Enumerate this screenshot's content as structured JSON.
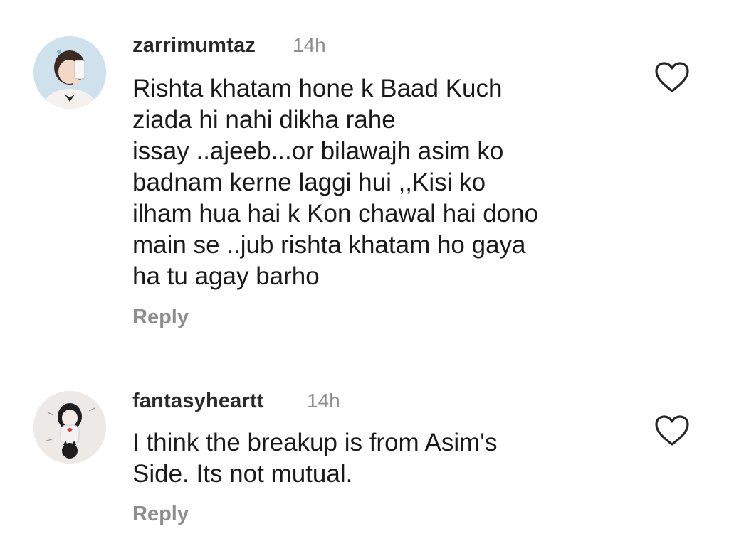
{
  "comments": [
    {
      "username": "zarrimumtaz",
      "timestamp": "14h",
      "text": "Rishta khatam hone k Baad Kuch\nziada hi nahi dikha rahe\nissay ..ajeeb...or bilawajh asim ko\nbadnam kerne laggi hui ,,Kisi ko\nilham hua hai k Kon chawal hai dono\nmain se ..jub rishta khatam ho gaya\nha tu agay barho",
      "reply_label": "Reply",
      "like_icon": "heart-outline-icon"
    },
    {
      "username": "fantasyheartt",
      "timestamp": "14h",
      "text": "I think the breakup is from Asim's\nSide.  Its not mutual.",
      "reply_label": "Reply",
      "like_icon": "heart-outline-icon"
    }
  ],
  "colors": {
    "username": "#2a2a2a",
    "text": "#1a1a1a",
    "muted": "#8e8e8e",
    "background": "#ffffff"
  }
}
